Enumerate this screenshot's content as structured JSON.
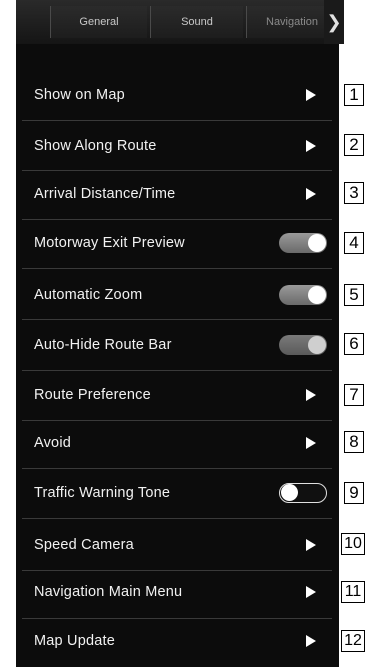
{
  "tabs": [
    {
      "label": "General"
    },
    {
      "label": "Sound"
    },
    {
      "label": "Navigation"
    }
  ],
  "tab_next_icon": "chevron-right-icon",
  "items": [
    {
      "label": "Show on Map",
      "control": "arrow",
      "callout": "1"
    },
    {
      "label": "Show Along Route",
      "control": "arrow",
      "callout": "2"
    },
    {
      "label": "Arrival Distance/Time",
      "control": "arrow",
      "callout": "3"
    },
    {
      "label": "Motorway Exit Preview",
      "control": "toggle",
      "state": "on",
      "callout": "4"
    },
    {
      "label": "Automatic Zoom",
      "control": "toggle",
      "state": "on",
      "callout": "5"
    },
    {
      "label": "Auto-Hide Route Bar",
      "control": "toggle",
      "state": "on-dimmed",
      "callout": "6"
    },
    {
      "label": "Route Preference",
      "control": "arrow",
      "callout": "7"
    },
    {
      "label": "Avoid",
      "control": "arrow",
      "callout": "8"
    },
    {
      "label": "Traffic Warning Tone",
      "control": "toggle",
      "state": "off",
      "callout": "9"
    },
    {
      "label": "Speed Camera",
      "control": "arrow",
      "callout": "10"
    },
    {
      "label": "Navigation Main Menu",
      "control": "arrow",
      "callout": "11"
    },
    {
      "label": "Map Update",
      "control": "arrow",
      "callout": "12"
    }
  ],
  "colors": {
    "background": "#0c0c0c",
    "text": "#f2f2f2",
    "divider": "#3a3a3a"
  }
}
